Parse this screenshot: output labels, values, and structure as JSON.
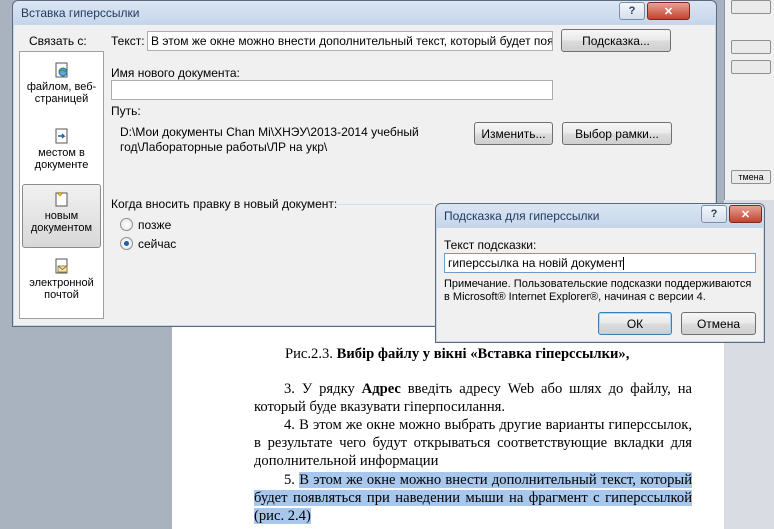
{
  "document": {
    "caption_prefix": "Рис.2.3.",
    "caption_bold": "Вибір файлу у вікні «Вставка гіперссылки»,",
    "p3_a": "3. У рядку ",
    "p3_bold": "Адрес",
    "p3_b": " введіть адресу Web або шлях до файлу, на который буде вказувати гіперпосилання.",
    "p4": "4. В этом же окне можно выбрать другие варианты гиперссылок, в результате чего будут открываться соответствующие вкладки для дополнительной информации",
    "p5_num": "5. ",
    "p5_text": "В этом же окне можно внести дополнительный текст, который будет появляться при наведении мыши на фрагмент с гиперссылкой (рис. 2.4)"
  },
  "background_window": {
    "button_label": "тмена"
  },
  "main_dialog": {
    "title": "Вставка гиперссылки",
    "help_glyph": "?",
    "close_glyph": "✕",
    "link_to_label": "Связать с:",
    "text_label": "Текст:",
    "text_value": "В этом же окне можно внести дополнительный текст, который будет появлят",
    "screentip_button": "Подсказка...",
    "new_doc_name_label": "Имя нового документа:",
    "new_doc_name_value": "",
    "path_label": "Путь:",
    "path_line1": "D:\\Мои документы Chan Mi\\ХНЭУ\\2013-2014 учебный",
    "path_line2": "год\\Лабораторные работы\\ЛР на укр\\",
    "change_button": "Изменить...",
    "target_frame_button": "Выбор рамки...",
    "when_edit_label": "Когда вносить правку в новый документ:",
    "radio_later": "позже",
    "radio_now": "сейчас",
    "selected_radio": "сейчас",
    "link_items": [
      {
        "line1": "файлом, веб-",
        "line2": "страницей",
        "icon": "web-page-icon"
      },
      {
        "line1": "местом в",
        "line2": "документе",
        "icon": "place-in-document-icon"
      },
      {
        "line1": "новым",
        "line2": "документом",
        "icon": "new-document-icon"
      },
      {
        "line1": "электронной",
        "line2": "почтой",
        "icon": "email-icon"
      }
    ],
    "selected_link": "новым документом"
  },
  "tip_dialog": {
    "title": "Подсказка для гиперссылки",
    "help_glyph": "?",
    "close_glyph": "✕",
    "field_label": "Текст подсказки:",
    "field_value": "гиперссылка на новій документ",
    "note_line1": "Примечание. Пользовательские подсказки поддерживаются",
    "note_line2": "в Microsoft® Internet Explorer®, начиная с версии 4.",
    "ok_button": "ОК",
    "cancel_button": "Отмена"
  }
}
